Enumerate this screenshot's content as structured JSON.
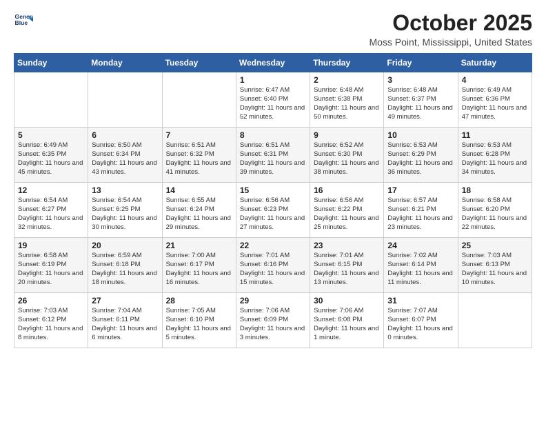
{
  "logo": {
    "line1": "General",
    "line2": "Blue"
  },
  "title": "October 2025",
  "subtitle": "Moss Point, Mississippi, United States",
  "header": {
    "days": [
      "Sunday",
      "Monday",
      "Tuesday",
      "Wednesday",
      "Thursday",
      "Friday",
      "Saturday"
    ]
  },
  "weeks": [
    [
      {
        "day": "",
        "content": ""
      },
      {
        "day": "",
        "content": ""
      },
      {
        "day": "",
        "content": ""
      },
      {
        "day": "1",
        "content": "Sunrise: 6:47 AM\nSunset: 6:40 PM\nDaylight: 11 hours and 52 minutes."
      },
      {
        "day": "2",
        "content": "Sunrise: 6:48 AM\nSunset: 6:38 PM\nDaylight: 11 hours and 50 minutes."
      },
      {
        "day": "3",
        "content": "Sunrise: 6:48 AM\nSunset: 6:37 PM\nDaylight: 11 hours and 49 minutes."
      },
      {
        "day": "4",
        "content": "Sunrise: 6:49 AM\nSunset: 6:36 PM\nDaylight: 11 hours and 47 minutes."
      }
    ],
    [
      {
        "day": "5",
        "content": "Sunrise: 6:49 AM\nSunset: 6:35 PM\nDaylight: 11 hours and 45 minutes."
      },
      {
        "day": "6",
        "content": "Sunrise: 6:50 AM\nSunset: 6:34 PM\nDaylight: 11 hours and 43 minutes."
      },
      {
        "day": "7",
        "content": "Sunrise: 6:51 AM\nSunset: 6:32 PM\nDaylight: 11 hours and 41 minutes."
      },
      {
        "day": "8",
        "content": "Sunrise: 6:51 AM\nSunset: 6:31 PM\nDaylight: 11 hours and 39 minutes."
      },
      {
        "day": "9",
        "content": "Sunrise: 6:52 AM\nSunset: 6:30 PM\nDaylight: 11 hours and 38 minutes."
      },
      {
        "day": "10",
        "content": "Sunrise: 6:53 AM\nSunset: 6:29 PM\nDaylight: 11 hours and 36 minutes."
      },
      {
        "day": "11",
        "content": "Sunrise: 6:53 AM\nSunset: 6:28 PM\nDaylight: 11 hours and 34 minutes."
      }
    ],
    [
      {
        "day": "12",
        "content": "Sunrise: 6:54 AM\nSunset: 6:27 PM\nDaylight: 11 hours and 32 minutes."
      },
      {
        "day": "13",
        "content": "Sunrise: 6:54 AM\nSunset: 6:25 PM\nDaylight: 11 hours and 30 minutes."
      },
      {
        "day": "14",
        "content": "Sunrise: 6:55 AM\nSunset: 6:24 PM\nDaylight: 11 hours and 29 minutes."
      },
      {
        "day": "15",
        "content": "Sunrise: 6:56 AM\nSunset: 6:23 PM\nDaylight: 11 hours and 27 minutes."
      },
      {
        "day": "16",
        "content": "Sunrise: 6:56 AM\nSunset: 6:22 PM\nDaylight: 11 hours and 25 minutes."
      },
      {
        "day": "17",
        "content": "Sunrise: 6:57 AM\nSunset: 6:21 PM\nDaylight: 11 hours and 23 minutes."
      },
      {
        "day": "18",
        "content": "Sunrise: 6:58 AM\nSunset: 6:20 PM\nDaylight: 11 hours and 22 minutes."
      }
    ],
    [
      {
        "day": "19",
        "content": "Sunrise: 6:58 AM\nSunset: 6:19 PM\nDaylight: 11 hours and 20 minutes."
      },
      {
        "day": "20",
        "content": "Sunrise: 6:59 AM\nSunset: 6:18 PM\nDaylight: 11 hours and 18 minutes."
      },
      {
        "day": "21",
        "content": "Sunrise: 7:00 AM\nSunset: 6:17 PM\nDaylight: 11 hours and 16 minutes."
      },
      {
        "day": "22",
        "content": "Sunrise: 7:01 AM\nSunset: 6:16 PM\nDaylight: 11 hours and 15 minutes."
      },
      {
        "day": "23",
        "content": "Sunrise: 7:01 AM\nSunset: 6:15 PM\nDaylight: 11 hours and 13 minutes."
      },
      {
        "day": "24",
        "content": "Sunrise: 7:02 AM\nSunset: 6:14 PM\nDaylight: 11 hours and 11 minutes."
      },
      {
        "day": "25",
        "content": "Sunrise: 7:03 AM\nSunset: 6:13 PM\nDaylight: 11 hours and 10 minutes."
      }
    ],
    [
      {
        "day": "26",
        "content": "Sunrise: 7:03 AM\nSunset: 6:12 PM\nDaylight: 11 hours and 8 minutes."
      },
      {
        "day": "27",
        "content": "Sunrise: 7:04 AM\nSunset: 6:11 PM\nDaylight: 11 hours and 6 minutes."
      },
      {
        "day": "28",
        "content": "Sunrise: 7:05 AM\nSunset: 6:10 PM\nDaylight: 11 hours and 5 minutes."
      },
      {
        "day": "29",
        "content": "Sunrise: 7:06 AM\nSunset: 6:09 PM\nDaylight: 11 hours and 3 minutes."
      },
      {
        "day": "30",
        "content": "Sunrise: 7:06 AM\nSunset: 6:08 PM\nDaylight: 11 hours and 1 minute."
      },
      {
        "day": "31",
        "content": "Sunrise: 7:07 AM\nSunset: 6:07 PM\nDaylight: 11 hours and 0 minutes."
      },
      {
        "day": "",
        "content": ""
      }
    ]
  ]
}
